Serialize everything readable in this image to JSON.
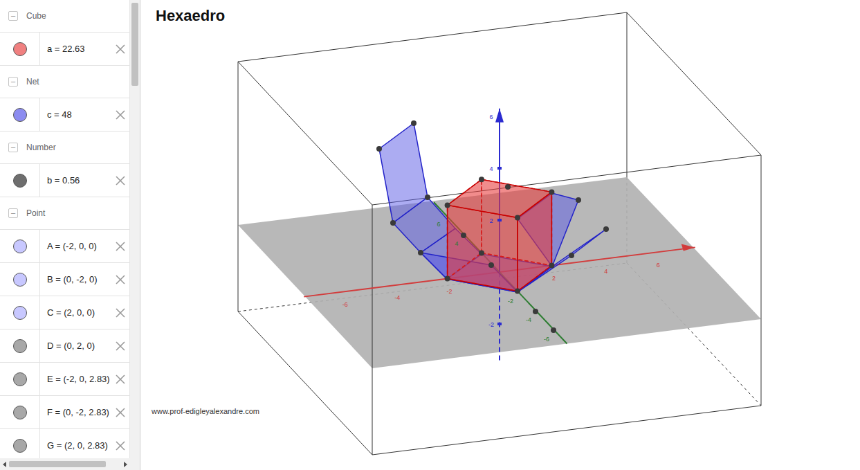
{
  "window": {
    "title": "Hexaedro"
  },
  "algebra": {
    "groups": [
      {
        "header": "Cube",
        "toggle": "–",
        "expanded": true,
        "items": [
          {
            "label": "a = 22.63",
            "color": "#f08080"
          }
        ]
      },
      {
        "header": "Net",
        "toggle": "–",
        "expanded": true,
        "items": [
          {
            "label": "c = 48",
            "color": "#8c8cf0"
          }
        ]
      },
      {
        "header": "Number",
        "toggle": "–",
        "expanded": true,
        "items": [
          {
            "label": "b = 0.56",
            "color": "#6e6e6e"
          }
        ]
      },
      {
        "header": "Point",
        "toggle": "–",
        "expanded": true,
        "items": [
          {
            "label": "A = (-2, 0, 0)",
            "color": "#c8c8ff"
          },
          {
            "label": "B = (0, -2, 0)",
            "color": "#c8c8ff"
          },
          {
            "label": "C = (2, 0, 0)",
            "color": "#c8c8ff"
          },
          {
            "label": "D = (0, 2, 0)",
            "color": "#a8a8a8"
          },
          {
            "label": "E = (-2, 0, 2.83)",
            "color": "#a8a8a8"
          },
          {
            "label": "F = (0, -2, 2.83)",
            "color": "#a8a8a8"
          },
          {
            "label": "G = (2, 0, 2.83)",
            "color": "#a8a8a8"
          }
        ]
      }
    ]
  },
  "view3d": {
    "watermark": "www.prof-edigleyalexandre.com",
    "axes": {
      "x": {
        "color": "#d23c3c",
        "ticks": [
          "-6",
          "-4",
          "-2",
          "2",
          "4",
          "6"
        ]
      },
      "y": {
        "color": "#2e7d32",
        "ticks": [
          "-6",
          "-4",
          "-2",
          "4",
          "6"
        ]
      },
      "z": {
        "color": "#2b2bd0",
        "ticks": [
          "6",
          "4",
          "2",
          "-2"
        ]
      }
    }
  }
}
